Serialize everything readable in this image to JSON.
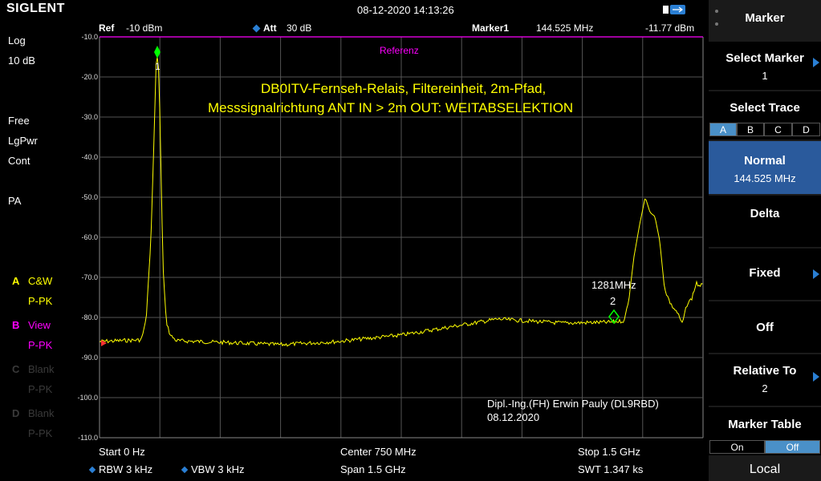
{
  "header": {
    "brand": "SIGLENT",
    "datetime": "08-12-2020 14:13:26"
  },
  "info": {
    "ref_label": "Ref",
    "ref_value": "-10 dBm",
    "att_label": "Att",
    "att_value": "30 dB",
    "marker_label": "Marker1",
    "marker_freq": "144.525 MHz",
    "marker_level": "-11.77 dBm"
  },
  "left_panel": {
    "scale_type": "Log",
    "scale_div": "10 dB",
    "mode1": "Free",
    "mode2": "LgPwr",
    "mode3": "Cont",
    "preamp": "PA",
    "traces": [
      {
        "letter": "A",
        "mode": "C&W",
        "det": "P-PK",
        "color": "#ffff00"
      },
      {
        "letter": "B",
        "mode": "View",
        "det": "P-PK",
        "color": "#ff00ff"
      },
      {
        "letter": "C",
        "mode": "Blank",
        "det": "P-PK",
        "color": "#3a3a3a"
      },
      {
        "letter": "D",
        "mode": "Blank",
        "det": "P-PK",
        "color": "#3a3a3a"
      }
    ]
  },
  "plot": {
    "y_labels": [
      "-10.0",
      "-20.0",
      "-30.0",
      "-40.0",
      "-50.0",
      "-60.0",
      "-70.0",
      "-80.0",
      "-90.0",
      "-100.0",
      "-110.0"
    ],
    "reference_label": "Referenz",
    "title_line1": "DB0ITV-Fernseh-Relais,  Filtereinheit,  2m-Pfad,",
    "title_line2": "Messsignalrichtung ANT IN  > 2m OUT:    WEITABSELEKTION",
    "marker1_num": "1",
    "marker2_num": "2",
    "marker2_freq": "1281MHz",
    "author": "Dipl.-Ing.(FH) Erwin Pauly (DL9RBD)",
    "date": "08.12.2020",
    "trace_color": "#ffff00",
    "ref_color": "#ff00ff",
    "marker_color": "#00ff00"
  },
  "bottom": {
    "start": "Start  0 Hz",
    "center": "Center  750 MHz",
    "stop": "Stop  1.5 GHz",
    "rbw": "RBW  3 kHz",
    "vbw": "VBW  3 kHz",
    "span": "Span    1.5 GHz",
    "swt": "SWT  1.347 ks"
  },
  "softkeys": {
    "title": "Marker",
    "select_marker": "Select Marker",
    "select_marker_val": "1",
    "select_trace": "Select Trace",
    "trace_opts": [
      "A",
      "B",
      "C",
      "D"
    ],
    "normal": "Normal",
    "normal_val": "144.525 MHz",
    "delta": "Delta",
    "fixed": "Fixed",
    "off": "Off",
    "relative_to": "Relative To",
    "relative_val": "2",
    "marker_table": "Marker Table",
    "on": "On",
    "off2": "Off",
    "local": "Local"
  }
}
